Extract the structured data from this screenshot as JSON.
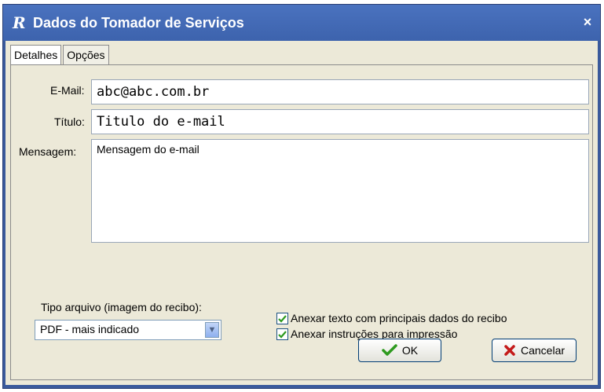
{
  "window": {
    "title": "Dados do Tomador de Serviços",
    "logo_glyph": "R",
    "close_glyph": "×"
  },
  "tabs": [
    {
      "label": "Detalhes",
      "active": true
    },
    {
      "label": "Opções",
      "active": false
    }
  ],
  "form": {
    "email_label": "E-Mail:",
    "email_value": "abc@abc.com.br",
    "title_label": "Título:",
    "title_value": "Titulo do e-mail",
    "message_label": "Mensagem:",
    "message_value": "Mensagem do e-mail",
    "file_type_label": "Tipo arquivo (imagem do recibo):",
    "file_type_value": "PDF - mais indicado"
  },
  "options": [
    {
      "label": "Anexar texto com principais dados do recibo",
      "checked": true
    },
    {
      "label": "Anexar instruções para impressão",
      "checked": true
    }
  ],
  "buttons": {
    "ok_label": "OK",
    "cancel_label": "Cancelar"
  },
  "icons": {
    "ok": "checkmark-icon",
    "cancel": "x-icon",
    "dropdown": "chevron-down-icon"
  },
  "colors": {
    "titlebar": "#3d63ad",
    "client_bg": "#ece9d8",
    "check_green": "#2e9a1f",
    "cancel_red": "#c41a1a"
  }
}
